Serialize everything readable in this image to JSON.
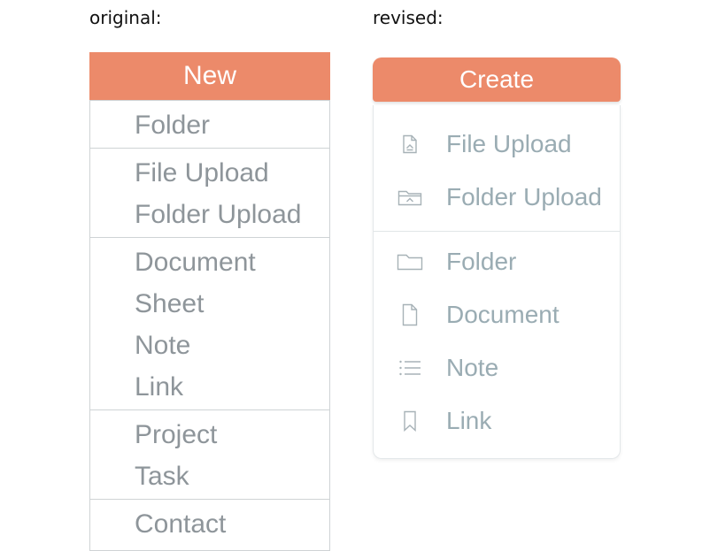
{
  "captions": {
    "original": "original:",
    "revised": "revised:"
  },
  "original": {
    "header": "New",
    "groups": [
      [
        "Folder"
      ],
      [
        "File Upload",
        "Folder Upload"
      ],
      [
        "Document",
        "Sheet",
        "Note",
        "Link"
      ],
      [
        "Project",
        "Task"
      ],
      [
        "Contact"
      ]
    ]
  },
  "revised": {
    "header": "Create",
    "groups": [
      [
        {
          "label": "File Upload",
          "icon": "file-upload-icon"
        },
        {
          "label": "Folder Upload",
          "icon": "folder-upload-icon"
        }
      ],
      [
        {
          "label": "Folder",
          "icon": "folder-icon"
        },
        {
          "label": "Document",
          "icon": "document-icon"
        },
        {
          "label": "Note",
          "icon": "list-icon"
        },
        {
          "label": "Link",
          "icon": "bookmark-icon"
        }
      ]
    ]
  },
  "colors": {
    "accent": "#ec8a6a",
    "item_text_original": "#8e959a",
    "item_text_revised": "#9aacb3"
  }
}
